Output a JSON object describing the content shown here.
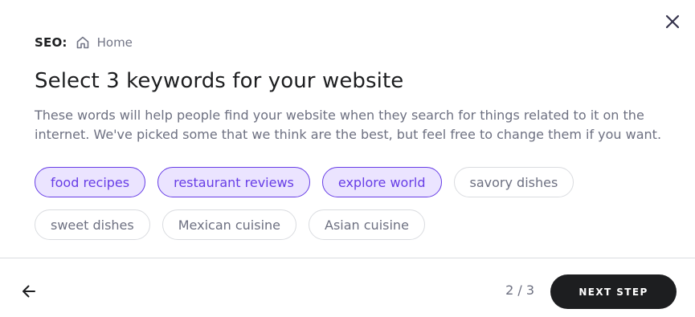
{
  "header": {
    "section_label": "SEO:",
    "page_label": "Home",
    "home_icon": "home-icon",
    "close_icon": "close-icon"
  },
  "main": {
    "title": "Select 3 keywords for your website",
    "description": "These words will help people find your website when they search for things related to it on the internet. We've picked some that we think are the best, but feel free to change them if you want."
  },
  "keywords": {
    "row1": [
      {
        "label": "food recipes",
        "selected": true
      },
      {
        "label": "restaurant reviews",
        "selected": true
      },
      {
        "label": "explore world",
        "selected": true
      },
      {
        "label": "savory dishes",
        "selected": false
      }
    ],
    "row2": [
      {
        "label": "sweet dishes",
        "selected": false
      },
      {
        "label": "Mexican cuisine",
        "selected": false
      },
      {
        "label": "Asian cuisine",
        "selected": false
      }
    ]
  },
  "footer": {
    "back_icon": "arrow-left-icon",
    "progress": "2 / 3",
    "next_label": "NEXT STEP"
  },
  "colors": {
    "accent": "#673de6",
    "accent_bg": "#ebe4ff",
    "primary_button": "#1d1e20",
    "text_dark": "#1d1e20",
    "text_muted": "#6d7081",
    "border": "#dadce0"
  }
}
